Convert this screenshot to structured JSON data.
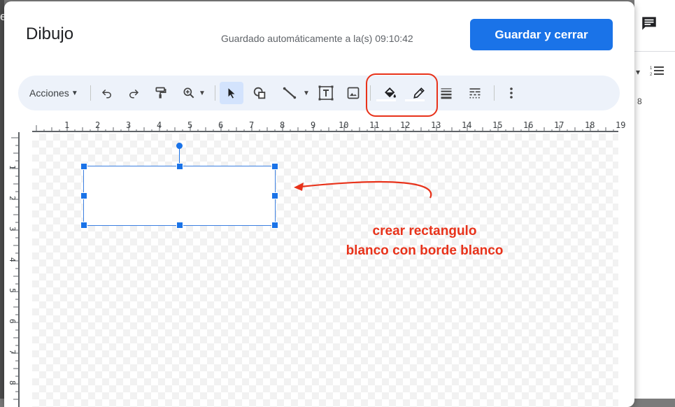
{
  "dialog": {
    "title": "Dibujo",
    "autosave_text": "Guardado automáticamente a la(s) 09:10:42",
    "save_button_label": "Guardar y cerrar"
  },
  "toolbar": {
    "actions_label": "Acciones",
    "items": [
      {
        "name": "undo-icon"
      },
      {
        "name": "redo-icon"
      },
      {
        "name": "paint-format-icon"
      },
      {
        "name": "zoom-icon"
      },
      {
        "name": "select-icon"
      },
      {
        "name": "shape-icon"
      },
      {
        "name": "line-icon"
      },
      {
        "name": "text-box-icon"
      },
      {
        "name": "image-icon"
      },
      {
        "name": "fill-color-icon"
      },
      {
        "name": "border-color-icon"
      },
      {
        "name": "border-weight-icon"
      },
      {
        "name": "border-dash-icon"
      },
      {
        "name": "more-icon"
      }
    ]
  },
  "ruler": {
    "horizontal": [
      "1",
      "2",
      "3",
      "4",
      "5",
      "6",
      "7",
      "8",
      "9",
      "10",
      "11",
      "12",
      "13",
      "14",
      "15",
      "16",
      "17",
      "18",
      "19"
    ],
    "vertical": [
      "1",
      "2",
      "3",
      "4",
      "5",
      "6",
      "7",
      "8"
    ]
  },
  "annotation": {
    "line1": "crear rectangulo",
    "line2": "blanco con borde blanco",
    "color": "#e8321a"
  },
  "background": {
    "left_char": "e",
    "ruler_number": "8"
  },
  "colors": {
    "accent": "#1a73e8",
    "toolbar_bg": "#edf2fa",
    "annotation": "#e8321a"
  }
}
